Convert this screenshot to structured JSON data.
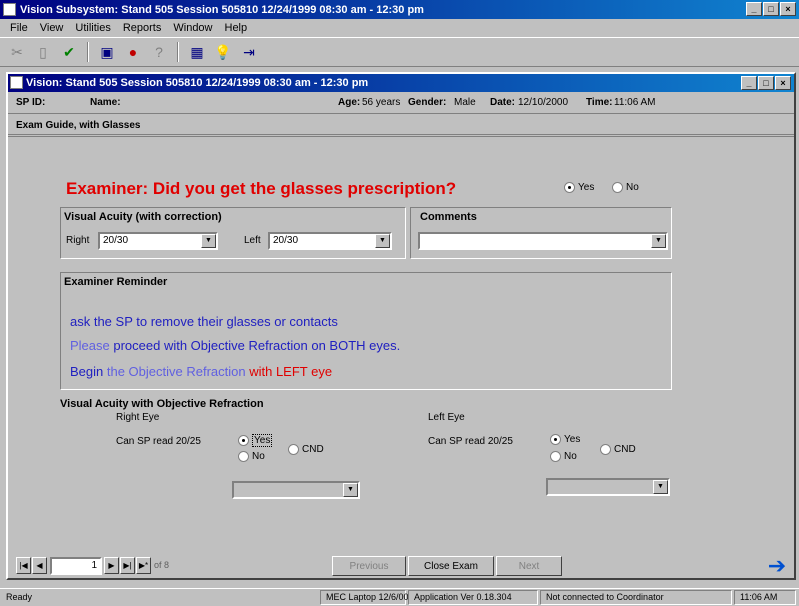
{
  "app": {
    "title": "Vision Subsystem: Stand 505 Session 505810 12/24/1999 08:30 am - 12:30 pm",
    "menu": [
      "File",
      "View",
      "Utilities",
      "Reports",
      "Window",
      "Help"
    ]
  },
  "child": {
    "title": "Vision: Stand 505 Session 505810 12/24/1999 08:30 am - 12:30 pm",
    "info": {
      "sp_label": "SP ID:",
      "name_label": "Name:",
      "age_label": "Age:",
      "age_value": "56 years",
      "gender_label": "Gender:",
      "gender_value": "Male",
      "date_label": "Date:",
      "date_value": "12/10/2000",
      "time_label": "Time:",
      "time_value": "11:06 AM"
    },
    "section": "Exam Guide, with Glasses"
  },
  "question": {
    "text": "Examiner: Did you get the glasses prescription?",
    "yes": "Yes",
    "no": "No"
  },
  "acuity": {
    "heading": "Visual Acuity (with correction)",
    "right_label": "Right",
    "right_value": "20/30",
    "left_label": "Left",
    "left_value": "20/30"
  },
  "comments": {
    "label": "Comments",
    "value": ""
  },
  "reminder": {
    "heading": "Examiner Reminder",
    "line1": "ask the SP to remove their glasses or contacts",
    "line2a": "Please",
    "line2b": " proceed with Objective Refraction on BOTH eyes.",
    "line3a": "Begin",
    "line3b": " the Objective Refraction ",
    "line3c": "with LEFT eye"
  },
  "objective": {
    "heading": "Visual Acuity with Objective Refraction",
    "right_eye": "Right Eye",
    "right_question": "Can SP read 20/25",
    "left_eye": "Left Eye",
    "left_question": "Can SP read 20/25",
    "yes": "Yes",
    "no": "No",
    "cnd": "CND"
  },
  "nav": {
    "record": "1",
    "of": "of 8",
    "btn_prev": "Previous",
    "btn_close": "Close Exam",
    "btn_next": "Next"
  },
  "status": {
    "ready": "Ready",
    "laptop": "MEC Laptop 12/6/00",
    "version": "Application Ver 0.18.304",
    "connection": "Not connected to Coordinator",
    "time": "11:06 AM"
  }
}
